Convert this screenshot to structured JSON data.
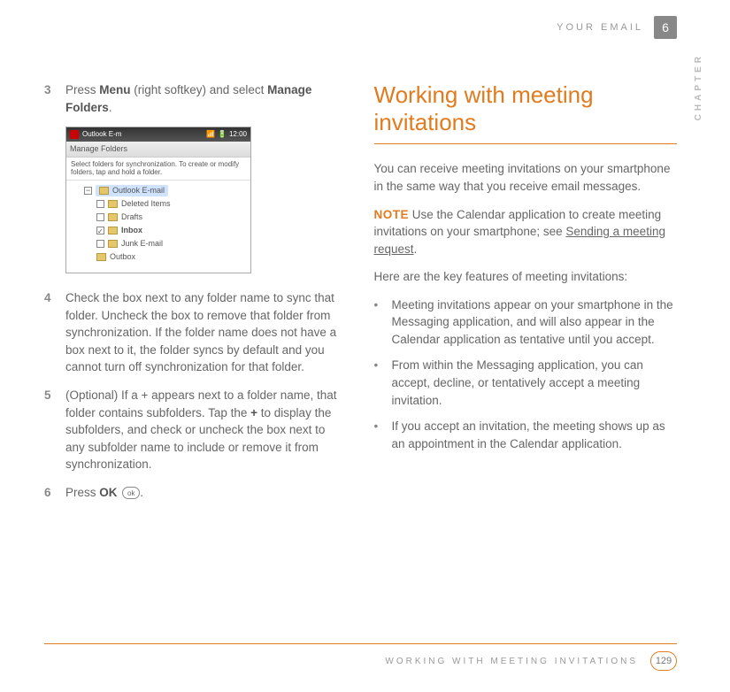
{
  "header": {
    "section": "YOUR EMAIL",
    "chapter_number": "6",
    "chapter_label": "CHAPTER"
  },
  "left": {
    "step3": {
      "num": "3",
      "pre": "Press ",
      "b1": "Menu",
      "mid": " (right softkey) and select ",
      "b2": "Manage Folders",
      "post": "."
    },
    "screenshot": {
      "title": "Outlook E-m",
      "time": "12:00",
      "subtitle": "Manage Folders",
      "hint": "Select folders for synchronization. To create or modify folders, tap and hold a folder.",
      "root": "Outlook E-mail",
      "items": [
        {
          "label": "Deleted Items",
          "checked": false
        },
        {
          "label": "Drafts",
          "checked": false
        },
        {
          "label": "Inbox",
          "checked": true,
          "bold": true
        },
        {
          "label": "Junk E-mail",
          "checked": false
        },
        {
          "label": "Outbox",
          "checked": false
        }
      ]
    },
    "step4": {
      "num": "4",
      "text": "Check the box next to any folder name to sync that folder. Uncheck the box to remove that folder from synchronization. If the folder name does not have a box next to it, the folder syncs by default and you cannot turn off synchronization for that folder."
    },
    "step5": {
      "num": "5",
      "pre": "(Optional) If a + appears next to a folder name, that folder contains subfolders. Tap the ",
      "b1": "+",
      "post": " to display the subfolders, and check or uncheck the box next to any subfolder name to include or remove it from synchronization."
    },
    "step6": {
      "num": "6",
      "pre": "Press ",
      "b1": "OK",
      "ok_icon": "ok",
      "post": "."
    }
  },
  "right": {
    "heading": "Working with meeting invitations",
    "p1": "You can receive meeting invitations on your smartphone in the same way that you receive email messages.",
    "note_label": "NOTE",
    "note_text_pre": "  Use the Calendar application to create meeting invitations on your smartphone; see ",
    "note_link": "Sending a meeting request",
    "note_text_post": ".",
    "p2": "Here are the key features of meeting invitations:",
    "bullets": [
      "Meeting invitations appear on your smartphone in the Messaging application, and will also appear in the Calendar application as tentative until you accept.",
      "From within the Messaging application, you can accept, decline, or tentatively accept a meeting invitation.",
      "If you accept an invitation, the meeting shows up as an appointment in the Calendar application."
    ]
  },
  "footer": {
    "text": "WORKING WITH MEETING INVITATIONS",
    "page": "129"
  }
}
